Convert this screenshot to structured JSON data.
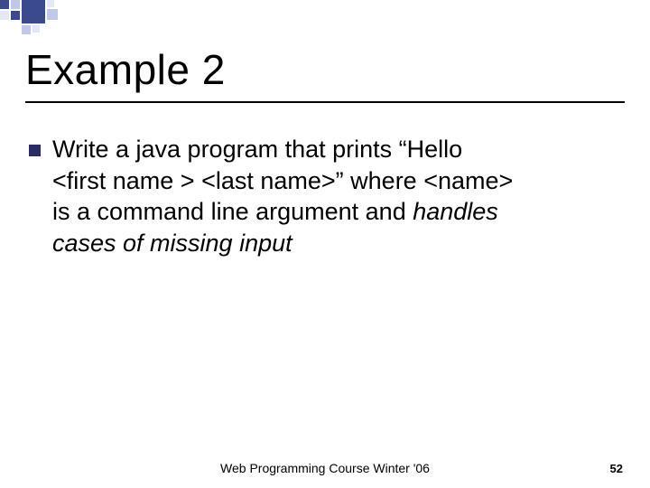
{
  "title": "Example 2",
  "bullet": {
    "line1_prefix": "Write a java program that prints “Hello",
    "line2": "<first name > <last name>” where <name>",
    "line3_prefix": "is a command line argument and ",
    "line3_italic": "handles",
    "line4_italic": "cases of missing input"
  },
  "footer": {
    "center": "Web Programming Course Winter '06",
    "page": "52"
  }
}
